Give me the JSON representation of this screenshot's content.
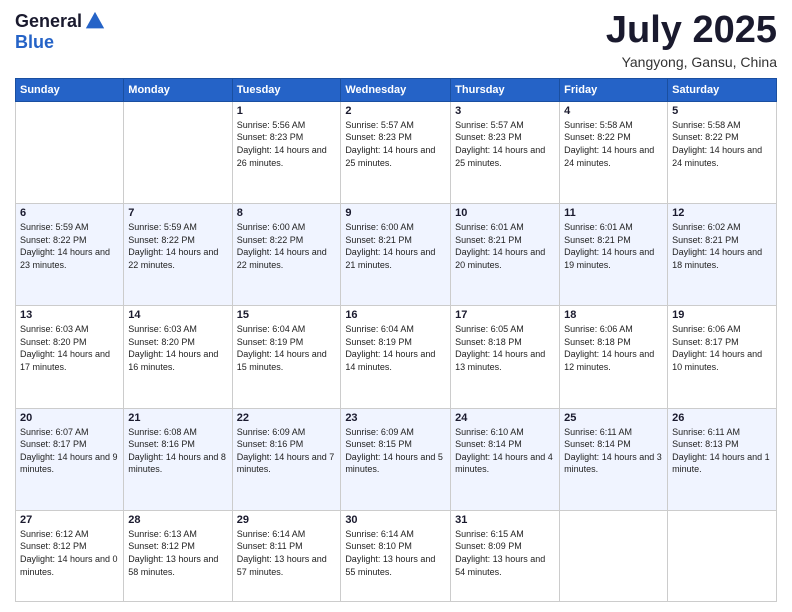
{
  "logo": {
    "general": "General",
    "blue": "Blue"
  },
  "header": {
    "month": "July 2025",
    "location": "Yangyong, Gansu, China"
  },
  "weekdays": [
    "Sunday",
    "Monday",
    "Tuesday",
    "Wednesday",
    "Thursday",
    "Friday",
    "Saturday"
  ],
  "weeks": [
    [
      {
        "day": "",
        "info": ""
      },
      {
        "day": "",
        "info": ""
      },
      {
        "day": "1",
        "info": "Sunrise: 5:56 AM\nSunset: 8:23 PM\nDaylight: 14 hours and 26 minutes."
      },
      {
        "day": "2",
        "info": "Sunrise: 5:57 AM\nSunset: 8:23 PM\nDaylight: 14 hours and 25 minutes."
      },
      {
        "day": "3",
        "info": "Sunrise: 5:57 AM\nSunset: 8:23 PM\nDaylight: 14 hours and 25 minutes."
      },
      {
        "day": "4",
        "info": "Sunrise: 5:58 AM\nSunset: 8:22 PM\nDaylight: 14 hours and 24 minutes."
      },
      {
        "day": "5",
        "info": "Sunrise: 5:58 AM\nSunset: 8:22 PM\nDaylight: 14 hours and 24 minutes."
      }
    ],
    [
      {
        "day": "6",
        "info": "Sunrise: 5:59 AM\nSunset: 8:22 PM\nDaylight: 14 hours and 23 minutes."
      },
      {
        "day": "7",
        "info": "Sunrise: 5:59 AM\nSunset: 8:22 PM\nDaylight: 14 hours and 22 minutes."
      },
      {
        "day": "8",
        "info": "Sunrise: 6:00 AM\nSunset: 8:22 PM\nDaylight: 14 hours and 22 minutes."
      },
      {
        "day": "9",
        "info": "Sunrise: 6:00 AM\nSunset: 8:21 PM\nDaylight: 14 hours and 21 minutes."
      },
      {
        "day": "10",
        "info": "Sunrise: 6:01 AM\nSunset: 8:21 PM\nDaylight: 14 hours and 20 minutes."
      },
      {
        "day": "11",
        "info": "Sunrise: 6:01 AM\nSunset: 8:21 PM\nDaylight: 14 hours and 19 minutes."
      },
      {
        "day": "12",
        "info": "Sunrise: 6:02 AM\nSunset: 8:21 PM\nDaylight: 14 hours and 18 minutes."
      }
    ],
    [
      {
        "day": "13",
        "info": "Sunrise: 6:03 AM\nSunset: 8:20 PM\nDaylight: 14 hours and 17 minutes."
      },
      {
        "day": "14",
        "info": "Sunrise: 6:03 AM\nSunset: 8:20 PM\nDaylight: 14 hours and 16 minutes."
      },
      {
        "day": "15",
        "info": "Sunrise: 6:04 AM\nSunset: 8:19 PM\nDaylight: 14 hours and 15 minutes."
      },
      {
        "day": "16",
        "info": "Sunrise: 6:04 AM\nSunset: 8:19 PM\nDaylight: 14 hours and 14 minutes."
      },
      {
        "day": "17",
        "info": "Sunrise: 6:05 AM\nSunset: 8:18 PM\nDaylight: 14 hours and 13 minutes."
      },
      {
        "day": "18",
        "info": "Sunrise: 6:06 AM\nSunset: 8:18 PM\nDaylight: 14 hours and 12 minutes."
      },
      {
        "day": "19",
        "info": "Sunrise: 6:06 AM\nSunset: 8:17 PM\nDaylight: 14 hours and 10 minutes."
      }
    ],
    [
      {
        "day": "20",
        "info": "Sunrise: 6:07 AM\nSunset: 8:17 PM\nDaylight: 14 hours and 9 minutes."
      },
      {
        "day": "21",
        "info": "Sunrise: 6:08 AM\nSunset: 8:16 PM\nDaylight: 14 hours and 8 minutes."
      },
      {
        "day": "22",
        "info": "Sunrise: 6:09 AM\nSunset: 8:16 PM\nDaylight: 14 hours and 7 minutes."
      },
      {
        "day": "23",
        "info": "Sunrise: 6:09 AM\nSunset: 8:15 PM\nDaylight: 14 hours and 5 minutes."
      },
      {
        "day": "24",
        "info": "Sunrise: 6:10 AM\nSunset: 8:14 PM\nDaylight: 14 hours and 4 minutes."
      },
      {
        "day": "25",
        "info": "Sunrise: 6:11 AM\nSunset: 8:14 PM\nDaylight: 14 hours and 3 minutes."
      },
      {
        "day": "26",
        "info": "Sunrise: 6:11 AM\nSunset: 8:13 PM\nDaylight: 14 hours and 1 minute."
      }
    ],
    [
      {
        "day": "27",
        "info": "Sunrise: 6:12 AM\nSunset: 8:12 PM\nDaylight: 14 hours and 0 minutes."
      },
      {
        "day": "28",
        "info": "Sunrise: 6:13 AM\nSunset: 8:12 PM\nDaylight: 13 hours and 58 minutes."
      },
      {
        "day": "29",
        "info": "Sunrise: 6:14 AM\nSunset: 8:11 PM\nDaylight: 13 hours and 57 minutes."
      },
      {
        "day": "30",
        "info": "Sunrise: 6:14 AM\nSunset: 8:10 PM\nDaylight: 13 hours and 55 minutes."
      },
      {
        "day": "31",
        "info": "Sunrise: 6:15 AM\nSunset: 8:09 PM\nDaylight: 13 hours and 54 minutes."
      },
      {
        "day": "",
        "info": ""
      },
      {
        "day": "",
        "info": ""
      }
    ]
  ]
}
